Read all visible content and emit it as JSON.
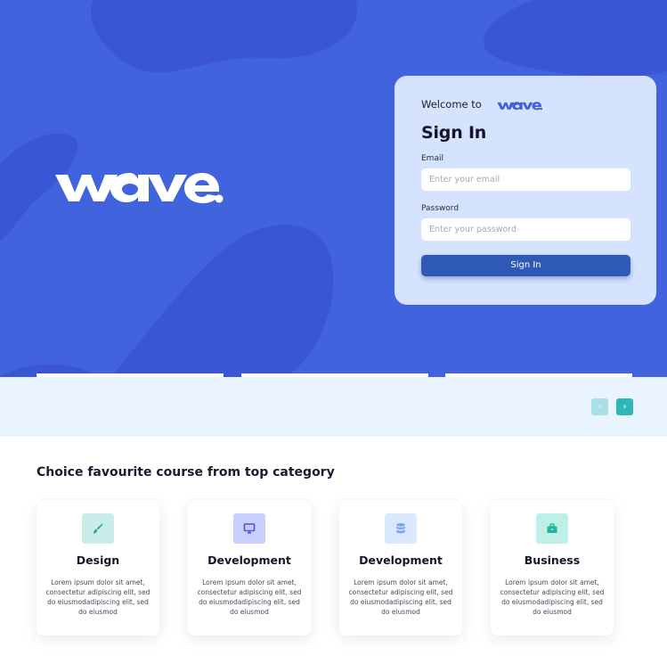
{
  "hero": {
    "brand_alt": "wave.",
    "background": "#4263de"
  },
  "login": {
    "welcome_text": "Welcome to",
    "brand_alt": "wave.",
    "title": "Sign In",
    "email_label": "Email",
    "email_placeholder": "Enter your email",
    "password_label": "Password",
    "password_placeholder": "Enter your password",
    "submit_label": "Sign In"
  },
  "carousel": {
    "prev_icon": "chevron-left-icon",
    "next_icon": "chevron-right-icon",
    "prev_glyph": "‹",
    "next_glyph": "›"
  },
  "categories": {
    "title": "Choice favourite course from top category",
    "items": [
      {
        "name": "Design",
        "icon": "brush-icon",
        "icon_bg": "#c9eeea",
        "icon_color": "#2fa79a",
        "description": "Lorem ipsum dolor sit amet, consectetur adipiscing elit, sed do eiusmodadipiscing elit, sed do eiusmod"
      },
      {
        "name": "Development",
        "icon": "monitor-icon",
        "icon_bg": "#c9cfff",
        "icon_color": "#4b57d6",
        "description": "Lorem ipsum dolor sit amet, consectetur adipiscing elit, sed do eiusmodadipiscing elit, sed do eiusmod"
      },
      {
        "name": "Development",
        "icon": "database-icon",
        "icon_bg": "#dbe9ff",
        "icon_color": "#7aa2ef",
        "description": "Lorem ipsum dolor sit amet, consectetur adipiscing elit, sed do eiusmodadipiscing elit, sed do eiusmod"
      },
      {
        "name": "Business",
        "icon": "briefcase-icon",
        "icon_bg": "#bff0e8",
        "icon_color": "#23b39e",
        "description": "Lorem ipsum dolor sit amet, consectetur adipiscing elit, sed do eiusmodadipiscing elit, sed do eiusmod"
      }
    ]
  }
}
